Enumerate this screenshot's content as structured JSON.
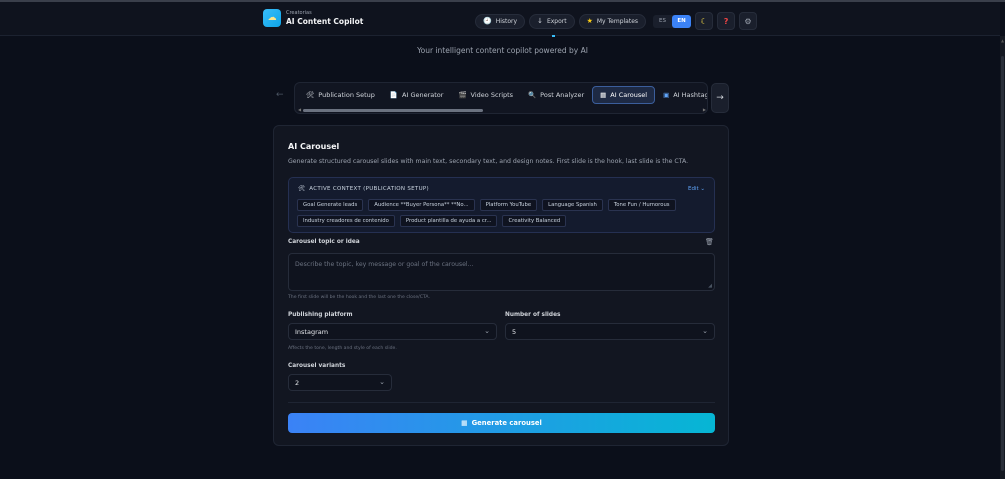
{
  "header": {
    "brand_sub": "Creatorias",
    "brand_title": "AI Content Copilot",
    "actions": {
      "history": "History",
      "export": "Export",
      "templates": "My Templates"
    },
    "lang": {
      "es": "ES",
      "en": "EN"
    }
  },
  "subtitle": "Your intelligent content copilot powered by AI",
  "tabs": [
    {
      "label": "Publication Setup"
    },
    {
      "label": "AI Generator"
    },
    {
      "label": "Video Scripts"
    },
    {
      "label": "Post Analyzer"
    },
    {
      "label": "AI Carousel"
    },
    {
      "label": "AI Hashtags"
    }
  ],
  "card": {
    "title": "AI Carousel",
    "description": "Generate structured carousel slides with main text, secondary text, and design notes. First slide is the hook, last slide is the CTA.",
    "context": {
      "heading": "ACTIVE CONTEXT (PUBLICATION SETUP)",
      "edit": "Edit ⌄",
      "chips": [
        "Goal Generate leads",
        "Audience **Buyer Persona** **No...",
        "Platform YouTube",
        "Language Spanish",
        "Tone Fun / Humorous",
        "Industry creadores de contenido",
        "Product plantilla de ayuda a cr...",
        "Creativity Balanced"
      ]
    },
    "topic": {
      "label": "Carousel topic or idea",
      "placeholder": "Describe the topic, key message or goal of the carousel...",
      "hint": "The first slide will be the hook and the last one the close/CTA."
    },
    "platform": {
      "label": "Publishing platform",
      "value": "Instagram",
      "hint": "Affects the tone, length and style of each slide."
    },
    "slides": {
      "label": "Number of slides",
      "value": "5"
    },
    "variants": {
      "label": "Carousel variants",
      "value": "2"
    },
    "generate": "Generate carousel"
  }
}
